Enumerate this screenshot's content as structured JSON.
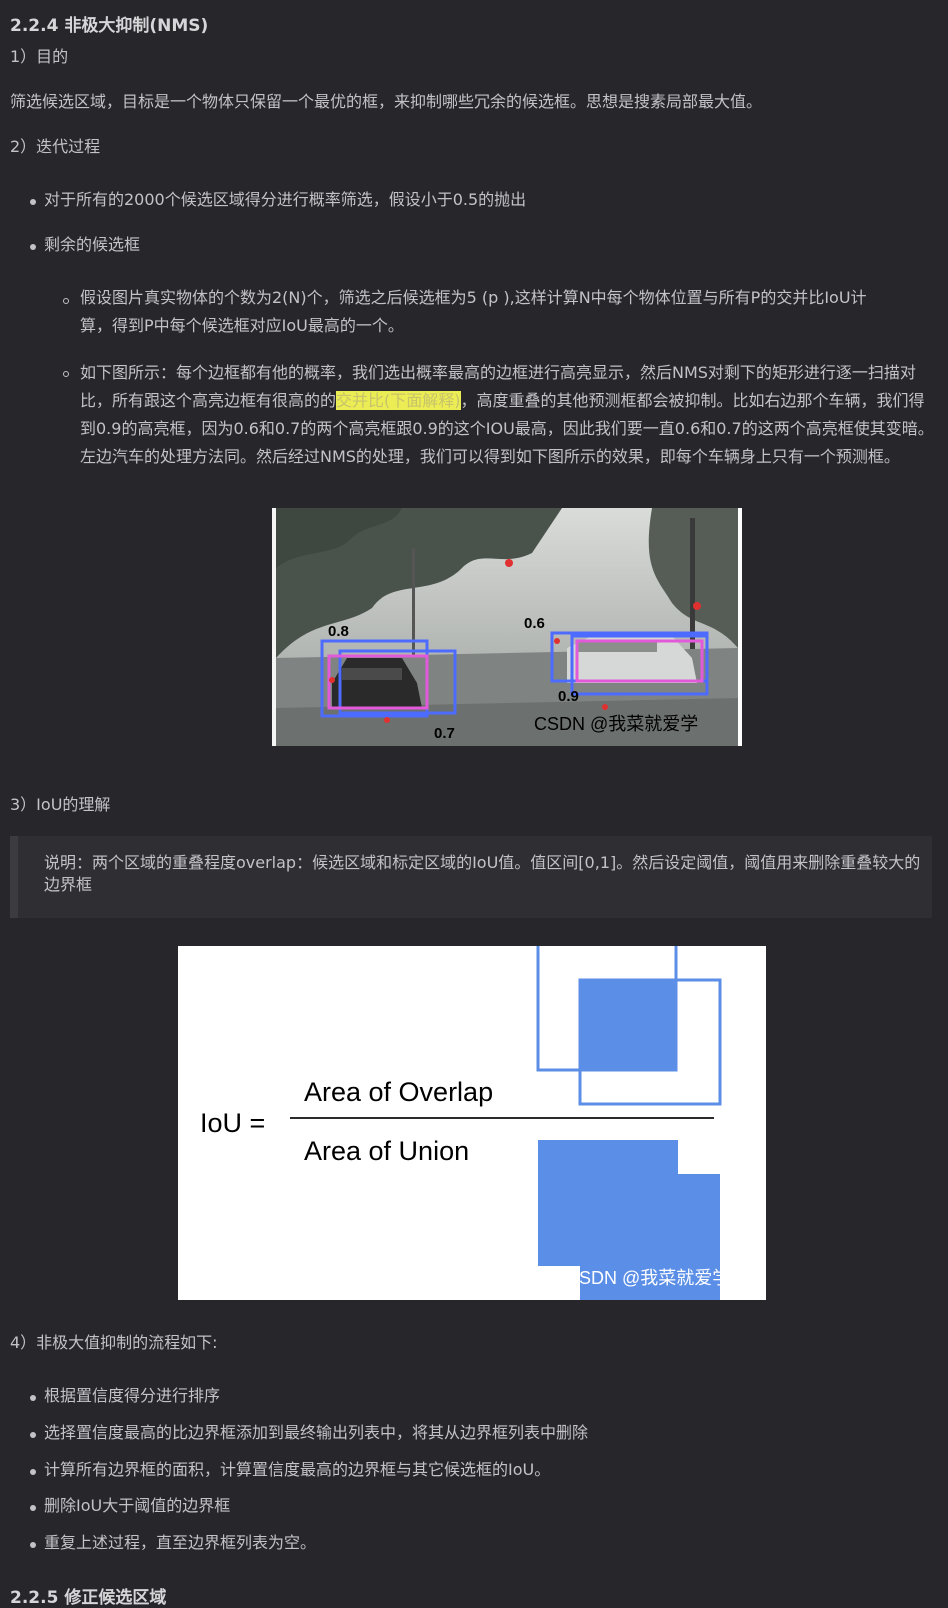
{
  "sections": {
    "nms": {
      "heading": "2.2.4 非极大抑制(NMS)",
      "purpose_title": "1）目的",
      "purpose_text": "筛选候选区域，目标是一个物体只保留一个最优的框，来抑制哪些冗余的候选框。思想是搜素局部最大值。",
      "iter_title": "2）迭代过程",
      "bullets": [
        "对于所有的2000个候选区域得分进行概率筛选，假设小于0.5的抛出",
        "剩余的候选框"
      ],
      "sub_bullets": {
        "first_line1": "假设图片真实物体的个数为2(N)个，筛选之后候选框为5 (p ),这样计算N中每个物体位置与所有P的交并比IoU计",
        "first_line2": "算，得到P中每个候选框对应IoU最高的一个。",
        "second_before": "如下图所示：每个边框都有他的概率，我们选出概率最高的边框进行高亮显示，然后NMS对剩下的矩形进行逐一扫描对比，所有跟这个高亮边框有很高的的",
        "second_highlight": "交并比(下面解释)",
        "second_after": "，高度重叠的其他预测框都会被抑制。比如右边那个车辆，我们得到0.9的高亮框，因为0.6和0.7的两个高亮框跟0.9的这个IOU最高，因此我们要一直0.6和0.7的这两个高亮框使其变暗。左边汽车的处理方法同。然后经过NMS的处理，我们可以得到如下图所示的效果，即每个车辆身上只有一个预测框。"
      },
      "photo": {
        "scores": [
          "0.8",
          "0.7",
          "0.6",
          "0.9"
        ],
        "watermark": "CSDN @我菜就爱学"
      }
    },
    "iou": {
      "title": "3）IoU的理解",
      "quote": "说明：两个区域的重叠程度overlap：候选区域和标定区域的IoU值。值区间[0,1]。然后设定阈值，阈值用来删除重叠较大的边界框",
      "formula_lhs": "IoU =",
      "numerator": "Area of Overlap",
      "denominator": "Area of Union",
      "watermark": "CSDN @我菜就爱学",
      "colors": {
        "fill": "#5b8ee6",
        "outline": "#5b8ee6"
      }
    },
    "flow": {
      "title": "4）非极大值抑制的流程如下:",
      "steps": [
        "根据置信度得分进行排序",
        "选择置信度最高的比边界框添加到最终输出列表中，将其从边界框列表中删除",
        "计算所有边界框的面积，计算置信度最高的边界框与其它候选框的IoU。",
        "删除IoU大于阈值的边界框",
        "重复上述过程，直至边界框列表为空。"
      ]
    },
    "next": {
      "heading": "2.2.5 修正候选区域"
    }
  },
  "colors": {
    "background": "#26262b",
    "text": "#c3c3c6",
    "highlight": "#ecec55",
    "quote_bg": "#2e2e33"
  }
}
